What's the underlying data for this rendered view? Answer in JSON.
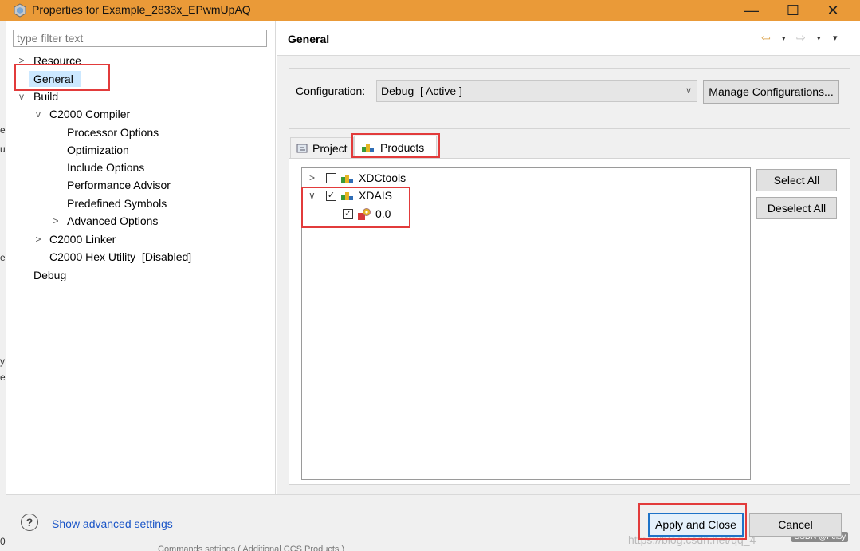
{
  "window": {
    "title": "Properties for Example_2833x_EPwmUpAQ",
    "minimize": "—",
    "maximize": "☐",
    "close": "✕",
    "title_bar_color": "#ea9a38"
  },
  "left_edge_chars": [
    "e",
    "u",
    "e",
    "y",
    "er",
    "0"
  ],
  "left_pane": {
    "filter_placeholder": "type filter text",
    "tree": [
      {
        "label": "Resource",
        "arrow": ">"
      },
      {
        "label": "General",
        "selected": true
      },
      {
        "label": "Build",
        "arrow": "v"
      },
      {
        "label": "C2000 Compiler",
        "arrow": "v"
      },
      {
        "label": "Processor Options"
      },
      {
        "label": "Optimization"
      },
      {
        "label": "Include Options"
      },
      {
        "label": "Performance Advisor"
      },
      {
        "label": "Predefined Symbols"
      },
      {
        "label": "Advanced Options",
        "arrow": ">"
      },
      {
        "label": "C2000 Linker",
        "arrow": ">"
      },
      {
        "label": "C2000 Hex Utility  [Disabled]"
      },
      {
        "label": "Debug"
      }
    ]
  },
  "right_pane": {
    "title": "General",
    "nav": {
      "back": "⇦",
      "forward": "⇨",
      "drop": "▾",
      "menu": "▾"
    },
    "configuration": {
      "label": "Configuration:",
      "value": "Debug  [ Active ]",
      "manage_button": "Manage Configurations..."
    },
    "tabs": [
      {
        "label": "Project",
        "active": false
      },
      {
        "label": "Products",
        "active": true
      }
    ],
    "products": [
      {
        "label": "XDCtools",
        "checked": false,
        "expanded": false
      },
      {
        "label": "XDAIS",
        "checked": true,
        "expanded": true,
        "children": [
          {
            "label": "0.0",
            "checked": true
          }
        ]
      }
    ],
    "select_all": "Select All",
    "deselect_all": "Deselect All"
  },
  "bottom": {
    "help": "?",
    "advanced_link": "Show advanced settings",
    "apply_close": "Apply and Close",
    "cancel": "Cancel",
    "watermark": "https://blog.csdn.net/qq_4",
    "badge": "CSDN @Feisy",
    "behind_text": "Commands  settings  ( Additional  CCS  Products )"
  },
  "colors": {
    "highlight": "#e23b3b",
    "selection": "#cce8ff",
    "link": "#1a55c7",
    "accent_blue": "#1e73c8"
  }
}
